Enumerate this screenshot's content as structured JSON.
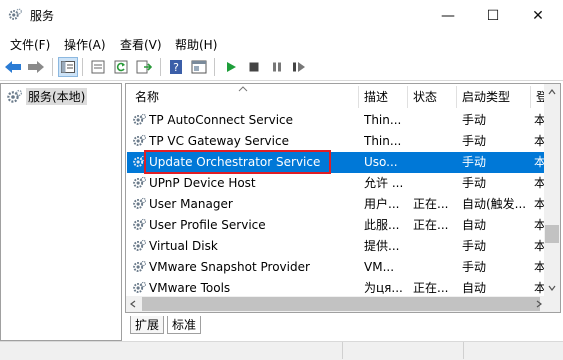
{
  "window": {
    "title": "服务",
    "icon": "services-gear-icon",
    "controls": {
      "minimize": "—",
      "maximize": "☐",
      "close": "✕"
    }
  },
  "menu": [
    {
      "label": "文件(F)"
    },
    {
      "label": "操作(A)"
    },
    {
      "label": "查看(V)"
    },
    {
      "label": "帮助(H)"
    }
  ],
  "toolbar": {
    "icons": [
      "back-arrow-icon",
      "forward-arrow-icon",
      "show-tree-icon",
      "properties-icon",
      "refresh-icon",
      "export-list-icon",
      "help-icon",
      "console-icon",
      "play-icon",
      "stop-icon",
      "pause-icon",
      "restart-icon"
    ],
    "colors": {
      "arrow": "#2a7bd4",
      "play": "#1e9e3a",
      "stop": "#444444"
    }
  },
  "tree": {
    "item_label": "服务(本地)"
  },
  "table": {
    "columns": [
      "名称",
      "描述",
      "状态",
      "启动类型",
      "登"
    ],
    "rows": [
      {
        "name": "TP AutoConnect Service",
        "desc": "Thin...",
        "status": "",
        "startup": "手动",
        "logon": "本"
      },
      {
        "name": "TP VC Gateway Service",
        "desc": "Thin...",
        "status": "",
        "startup": "手动",
        "logon": "本"
      },
      {
        "name": "Update Orchestrator Service",
        "desc": "Uso...",
        "status": "",
        "startup": "手动",
        "logon": "本",
        "selected": true
      },
      {
        "name": "UPnP Device Host",
        "desc": "允许 ...",
        "status": "",
        "startup": "手动",
        "logon": "本"
      },
      {
        "name": "User Manager",
        "desc": "用户...",
        "status": "正在...",
        "startup": "自动(触发...",
        "logon": "本"
      },
      {
        "name": "User Profile Service",
        "desc": "此服...",
        "status": "正在...",
        "startup": "自动",
        "logon": "本"
      },
      {
        "name": "Virtual Disk",
        "desc": "提供...",
        "status": "",
        "startup": "手动",
        "logon": "本"
      },
      {
        "name": "VMware Snapshot Provider",
        "desc": "VM...",
        "status": "",
        "startup": "手动",
        "logon": "本"
      },
      {
        "name": "VMware Tools",
        "desc": "为ця...",
        "status": "正在...",
        "startup": "自动",
        "logon": "本"
      }
    ],
    "selection_color": "#0078d7",
    "highlight_color": "#e01e25"
  },
  "tabs": [
    {
      "label": "扩展"
    },
    {
      "label": "标准",
      "active": true
    }
  ]
}
